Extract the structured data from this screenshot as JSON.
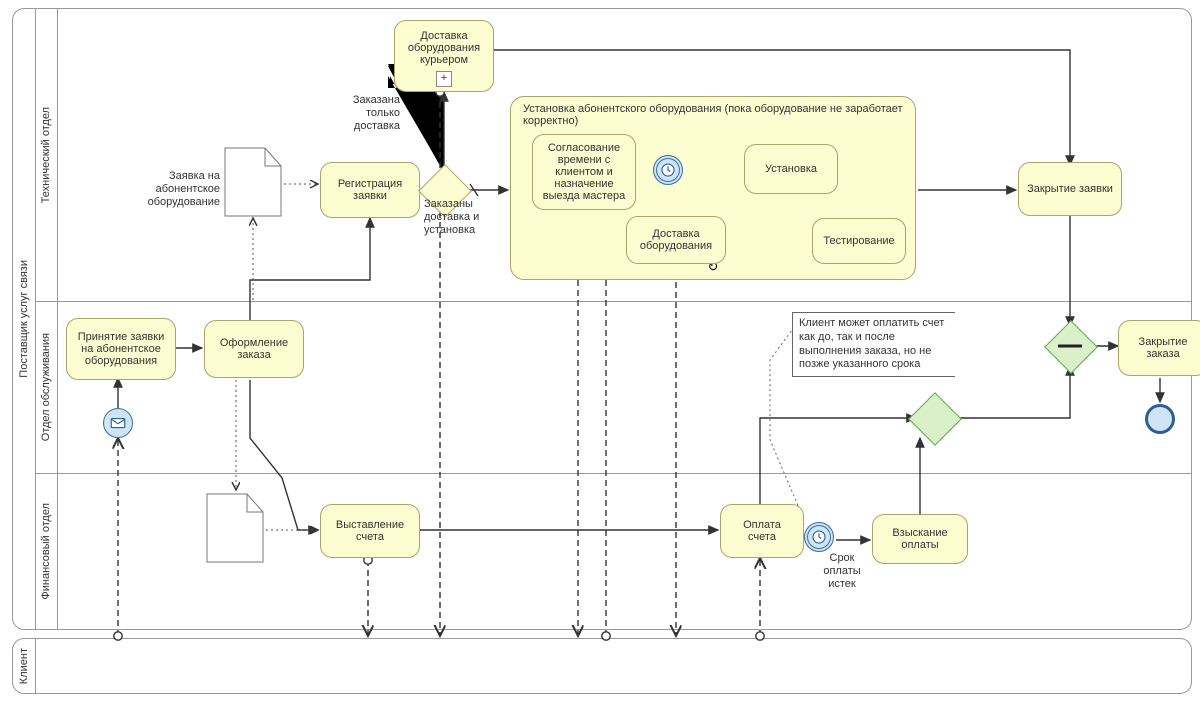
{
  "pools": {
    "provider": "Поставщик услуг связи",
    "client": "Клиент"
  },
  "lanes": {
    "tech": "Технический отдел",
    "service": "Отдел обслуживания",
    "finance": "Финансовый отдел"
  },
  "tasks": {
    "accept_request": "Принятие заявки\nна абонентское\nоборудования",
    "order_form": "Оформление\nзаказа",
    "registration": "Регистрация\nзаявки",
    "courier_delivery": "Доставка\nоборудования\nкурьером",
    "close_request": "Закрытие заявки",
    "close_order": "Закрытие заказа",
    "invoice": "Выставление\nсчета",
    "pay_invoice": "Оплата\nсчета",
    "collect_payment": "Взыскание\nоплаты"
  },
  "subprocess": {
    "title": "Установка абонентского оборудования (пока оборудование не заработает корректно)",
    "tasks": {
      "schedule": "Согласование\nвремени с\nклиентом и\nназначение\nвыезда мастера",
      "delivery": "Доставка\nоборудования",
      "install": "Установка",
      "testing": "Тестирование"
    }
  },
  "labels": {
    "only_delivery": "Заказана\nтолько\nдоставка",
    "delivery_and_install": "Заказаны\nдоставка и\nустановка",
    "doc_request": "Заявка на\nабонентское\nоборудование",
    "timer_label": "Срок\nоплаты\nистек"
  },
  "annotation": "Клиент может оплатить счет как до, так и после выполнения заказа, но не позже указанного срока",
  "icons": {
    "plus": "+",
    "message": "message-icon",
    "timer": "timer-icon",
    "loop": "loop-icon"
  }
}
